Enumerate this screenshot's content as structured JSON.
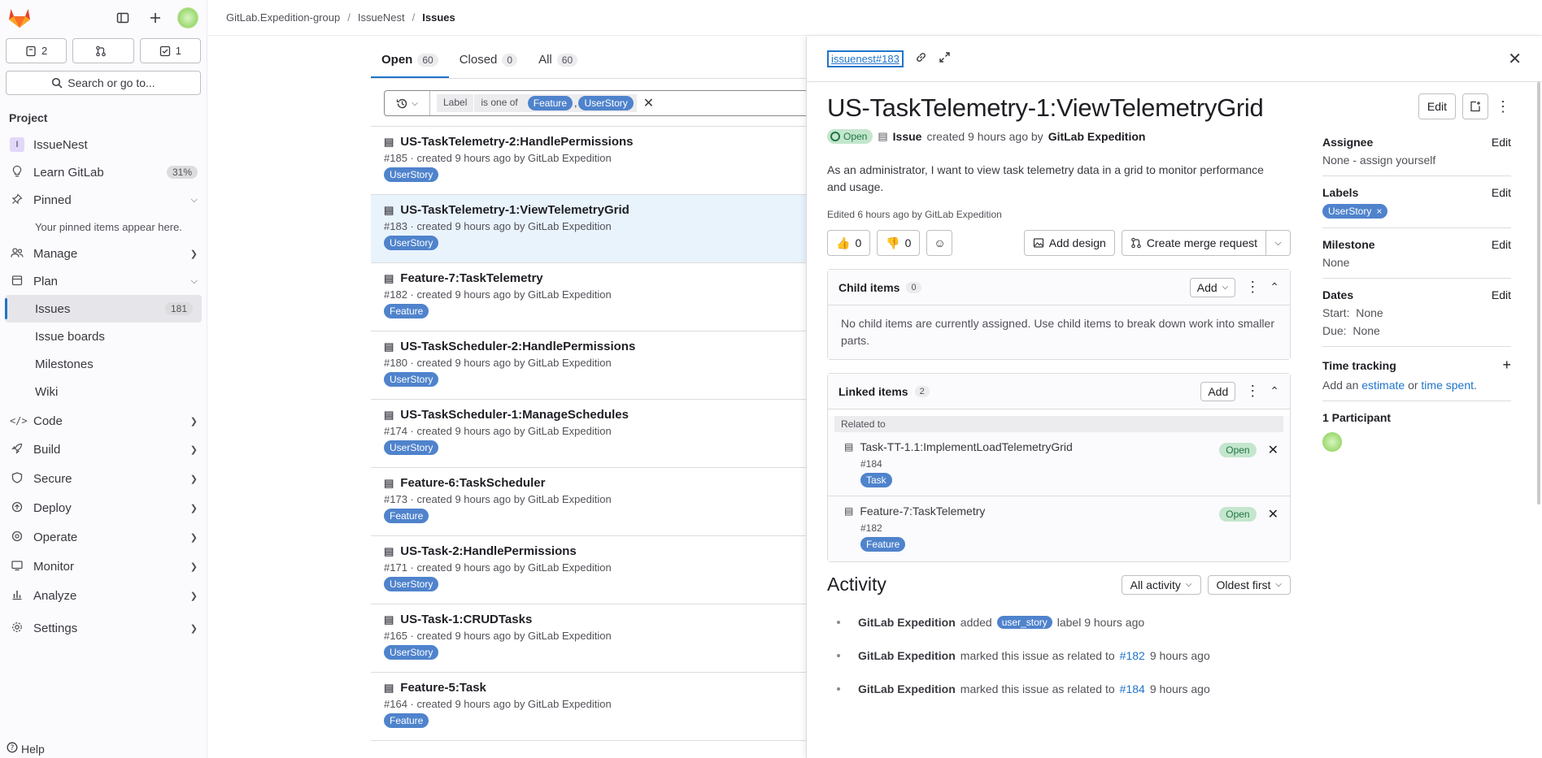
{
  "sidebar": {
    "counters": [
      {
        "icon": "issues-icon",
        "value": "2"
      },
      {
        "icon": "merge-request-icon",
        "value": ""
      },
      {
        "icon": "todo-icon",
        "value": "1"
      }
    ],
    "search_label": "Search or go to...",
    "section_title": "Project",
    "project_name": "IssueNest",
    "project_letter": "I",
    "learn_label": "Learn GitLab",
    "learn_badge": "31%",
    "pinned_label": "Pinned",
    "pinned_note": "Your pinned items appear here.",
    "manage_label": "Manage",
    "plan_label": "Plan",
    "plan_items": [
      {
        "label": "Issues",
        "badge": "181"
      },
      {
        "label": "Issue boards"
      },
      {
        "label": "Milestones"
      },
      {
        "label": "Wiki"
      }
    ],
    "groups": [
      "Code",
      "Build",
      "Secure",
      "Deploy",
      "Operate",
      "Monitor",
      "Analyze"
    ],
    "settings_label": "Settings",
    "help_label": "Help"
  },
  "breadcrumb": {
    "group": "GitLab.Expedition-group",
    "project": "IssueNest",
    "current": "Issues"
  },
  "list": {
    "tabs": [
      {
        "label": "Open",
        "count": "60"
      },
      {
        "label": "Closed",
        "count": "0"
      },
      {
        "label": "All",
        "count": "60"
      }
    ],
    "filter": {
      "key": "Label",
      "operator": "is one of",
      "values": [
        "Feature",
        "UserStory"
      ],
      "comma": ","
    },
    "issues": [
      {
        "title": "US-TaskTelemetry-2:HandlePermissions",
        "meta": "#185 · created 9 hours ago by GitLab Expedition",
        "label": "UserStory"
      },
      {
        "title": "US-TaskTelemetry-1:ViewTelemetryGrid",
        "meta": "#183 · created 9 hours ago by GitLab Expedition",
        "label": "UserStory"
      },
      {
        "title": "Feature-7:TaskTelemetry",
        "meta": "#182 · created 9 hours ago by GitLab Expedition",
        "label": "Feature"
      },
      {
        "title": "US-TaskScheduler-2:HandlePermissions",
        "meta": "#180 · created 9 hours ago by GitLab Expedition",
        "label": "UserStory"
      },
      {
        "title": "US-TaskScheduler-1:ManageSchedules",
        "meta": "#174 · created 9 hours ago by GitLab Expedition",
        "label": "UserStory"
      },
      {
        "title": "Feature-6:TaskScheduler",
        "meta": "#173 · created 9 hours ago by GitLab Expedition",
        "label": "Feature"
      },
      {
        "title": "US-Task-2:HandlePermissions",
        "meta": "#171 · created 9 hours ago by GitLab Expedition",
        "label": "UserStory"
      },
      {
        "title": "US-Task-1:CRUDTasks",
        "meta": "#165 · created 9 hours ago by GitLab Expedition",
        "label": "UserStory"
      },
      {
        "title": "Feature-5:Task",
        "meta": "#164 · created 9 hours ago by GitLab Expedition",
        "label": "Feature"
      }
    ]
  },
  "drawer": {
    "ref": "issuenest#183",
    "title": "US-TaskTelemetry-1:ViewTelemetryGrid",
    "status": "Open",
    "type_label": "Issue",
    "created_text": "created 9 hours ago by",
    "author": "GitLab Expedition",
    "description": "As an administrator, I want to view task telemetry data in a grid to monitor performance and usage.",
    "edited": "Edited 6 hours ago by GitLab Expedition",
    "thumbs_up": "0",
    "thumbs_down": "0",
    "add_design": "Add design",
    "create_mr": "Create merge request",
    "edit_label": "Edit",
    "child_items": {
      "title": "Child items",
      "count": "0",
      "add": "Add",
      "empty": "No child items are currently assigned. Use child items to break down work into smaller parts."
    },
    "linked_items": {
      "title": "Linked items",
      "count": "2",
      "add": "Add",
      "group": "Related to",
      "items": [
        {
          "title": "Task-TT-1.1:ImplementLoadTelemetryGrid",
          "ref": "#184",
          "label": "Task",
          "status": "Open"
        },
        {
          "title": "Feature-7:TaskTelemetry",
          "ref": "#182",
          "label": "Feature",
          "status": "Open"
        }
      ]
    },
    "activity": {
      "title": "Activity",
      "filter": "All activity",
      "sort": "Oldest first",
      "items": [
        {
          "author": "GitLab Expedition",
          "text1": "added",
          "label": "user_story",
          "text2": "label 9 hours ago"
        },
        {
          "author": "GitLab Expedition",
          "text1": "marked this issue as related to",
          "link": "#182",
          "text2": "9 hours ago"
        },
        {
          "author": "GitLab Expedition",
          "text1": "marked this issue as related to",
          "link": "#184",
          "text2": "9 hours ago"
        }
      ]
    },
    "side": {
      "assignee_title": "Assignee",
      "assignee_value": "None - assign yourself",
      "labels_title": "Labels",
      "label_value": "UserStory",
      "milestone_title": "Milestone",
      "milestone_value": "None",
      "dates_title": "Dates",
      "start": "Start:  None",
      "due": "Due:  None",
      "time_title": "Time tracking",
      "time_prefix": "Add an",
      "time_estimate": "estimate",
      "time_or": "or",
      "time_spent": "time spent",
      "time_suffix": ".",
      "participants": "1 Participant",
      "edit": "Edit"
    }
  }
}
